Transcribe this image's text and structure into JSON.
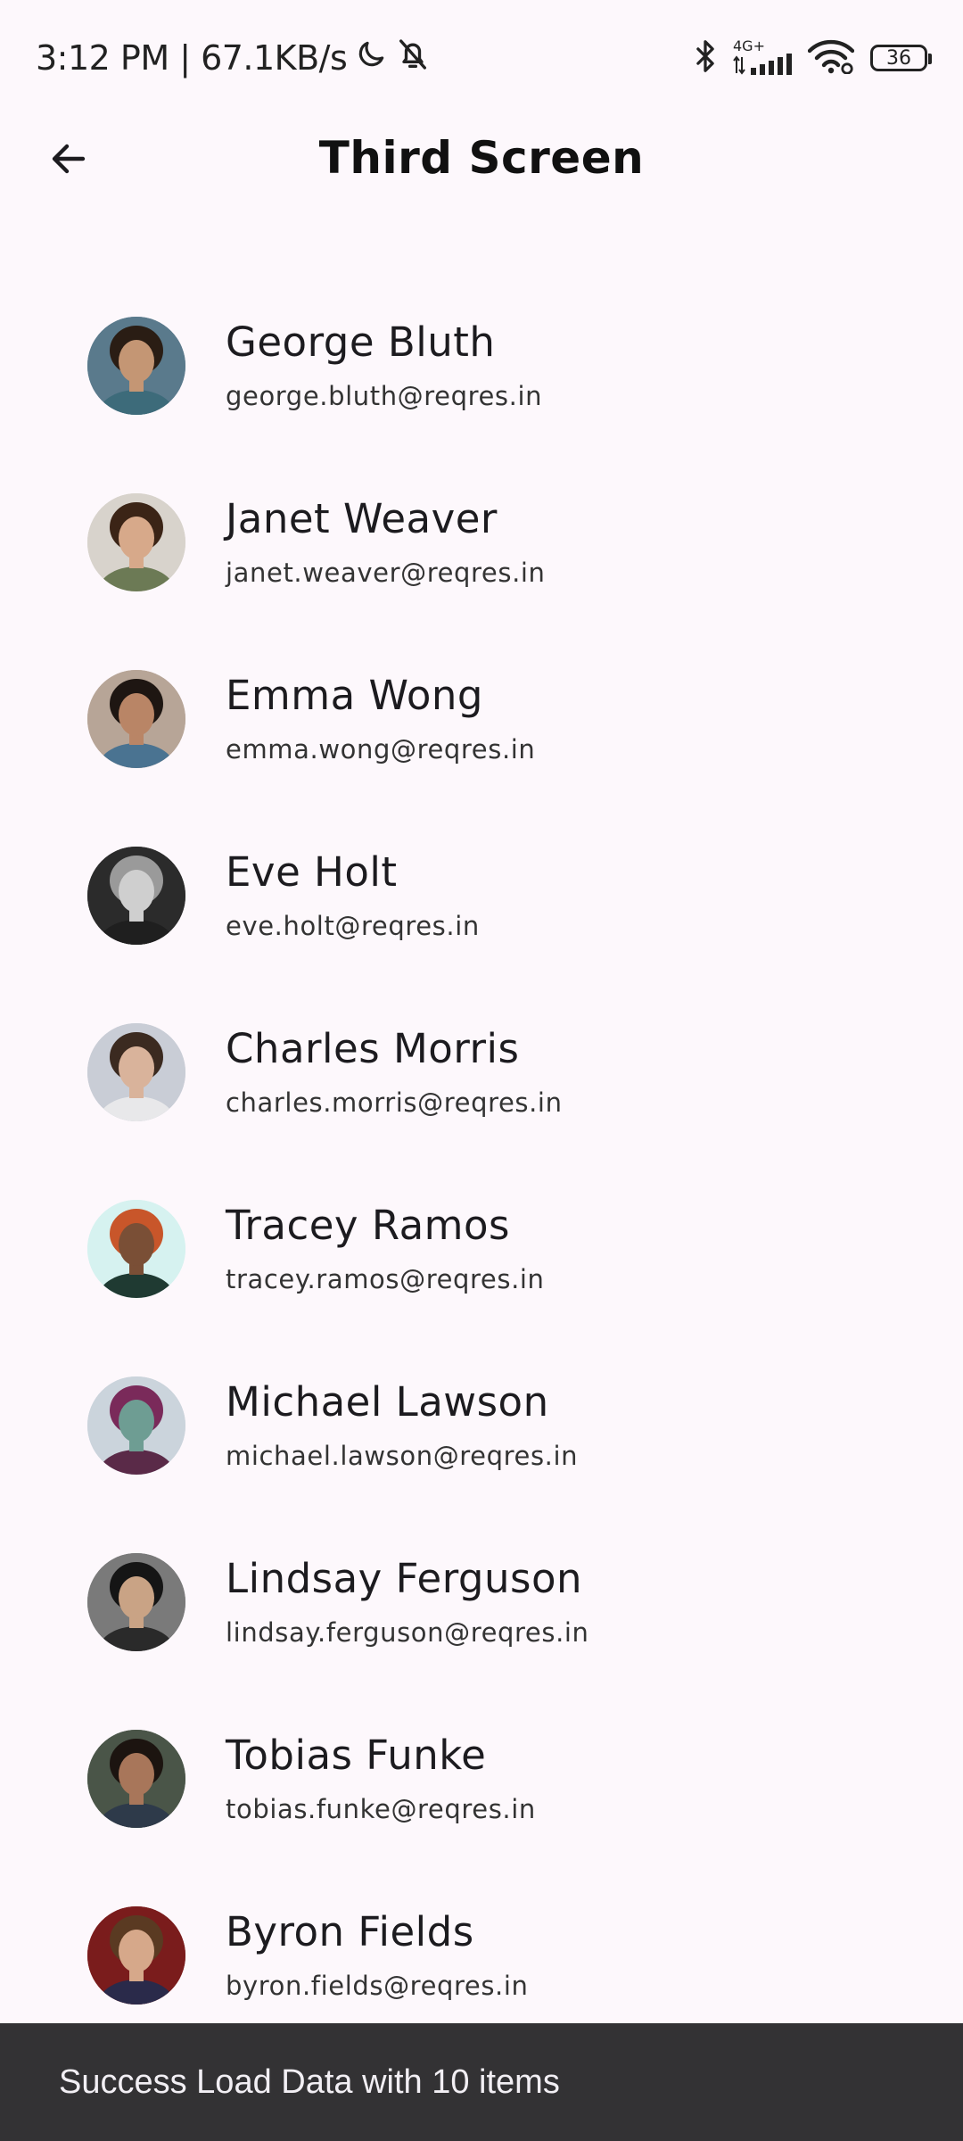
{
  "status_bar": {
    "time_and_speed": "3:12 PM | 67.1KB/s",
    "network_label": "4G+",
    "battery": "36"
  },
  "app_bar": {
    "title": "Third Screen"
  },
  "users": [
    {
      "name": "George Bluth",
      "email": "george.bluth@reqres.in",
      "avatar_bg": "#5a7a8c",
      "skin": "#c49674",
      "hair": "#2a1d14",
      "shirt": "#3d6b7a"
    },
    {
      "name": "Janet Weaver",
      "email": "janet.weaver@reqres.in",
      "avatar_bg": "#d8d3cc",
      "skin": "#d7a98a",
      "hair": "#3b2416",
      "shirt": "#6c7a55"
    },
    {
      "name": "Emma Wong",
      "email": "emma.wong@reqres.in",
      "avatar_bg": "#b7a597",
      "skin": "#b98566",
      "hair": "#1e1612",
      "shirt": "#4a7391"
    },
    {
      "name": "Eve Holt",
      "email": "eve.holt@reqres.in",
      "avatar_bg": "#2b2b2b",
      "skin": "#cfcfcf",
      "hair": "#9a9a9a",
      "shirt": "#1f1f1f"
    },
    {
      "name": "Charles Morris",
      "email": "charles.morris@reqres.in",
      "avatar_bg": "#c9cdd6",
      "skin": "#d9b39b",
      "hair": "#3b2a20",
      "shirt": "#e8e8ea"
    },
    {
      "name": "Tracey Ramos",
      "email": "tracey.ramos@reqres.in",
      "avatar_bg": "#d6f2f0",
      "skin": "#7a4f36",
      "hair": "#c8562a",
      "shirt": "#1f3a32"
    },
    {
      "name": "Michael Lawson",
      "email": "michael.lawson@reqres.in",
      "avatar_bg": "#cbd4dc",
      "skin": "#6e9d93",
      "hair": "#7a2a5a",
      "shirt": "#5a2a48"
    },
    {
      "name": "Lindsay Ferguson",
      "email": "lindsay.ferguson@reqres.in",
      "avatar_bg": "#7a7a7a",
      "skin": "#c9a385",
      "hair": "#151515",
      "shirt": "#2a2a2a"
    },
    {
      "name": "Tobias Funke",
      "email": "tobias.funke@reqres.in",
      "avatar_bg": "#4a5548",
      "skin": "#a8765a",
      "hair": "#1c1410",
      "shirt": "#2e3a4a"
    },
    {
      "name": "Byron Fields",
      "email": "byron.fields@reqres.in",
      "avatar_bg": "#7a1c1c",
      "skin": "#d6a88a",
      "hair": "#5a3a22",
      "shirt": "#2a2a4a"
    }
  ],
  "snackbar": {
    "message": "Success Load Data with 10 items"
  },
  "icons": {
    "back": "arrow-left-icon",
    "moon": "moon-icon",
    "bell_off": "bell-off-icon",
    "bluetooth": "bluetooth-icon",
    "signal": "signal-icon",
    "wifi": "wifi-icon",
    "battery": "battery-icon"
  }
}
